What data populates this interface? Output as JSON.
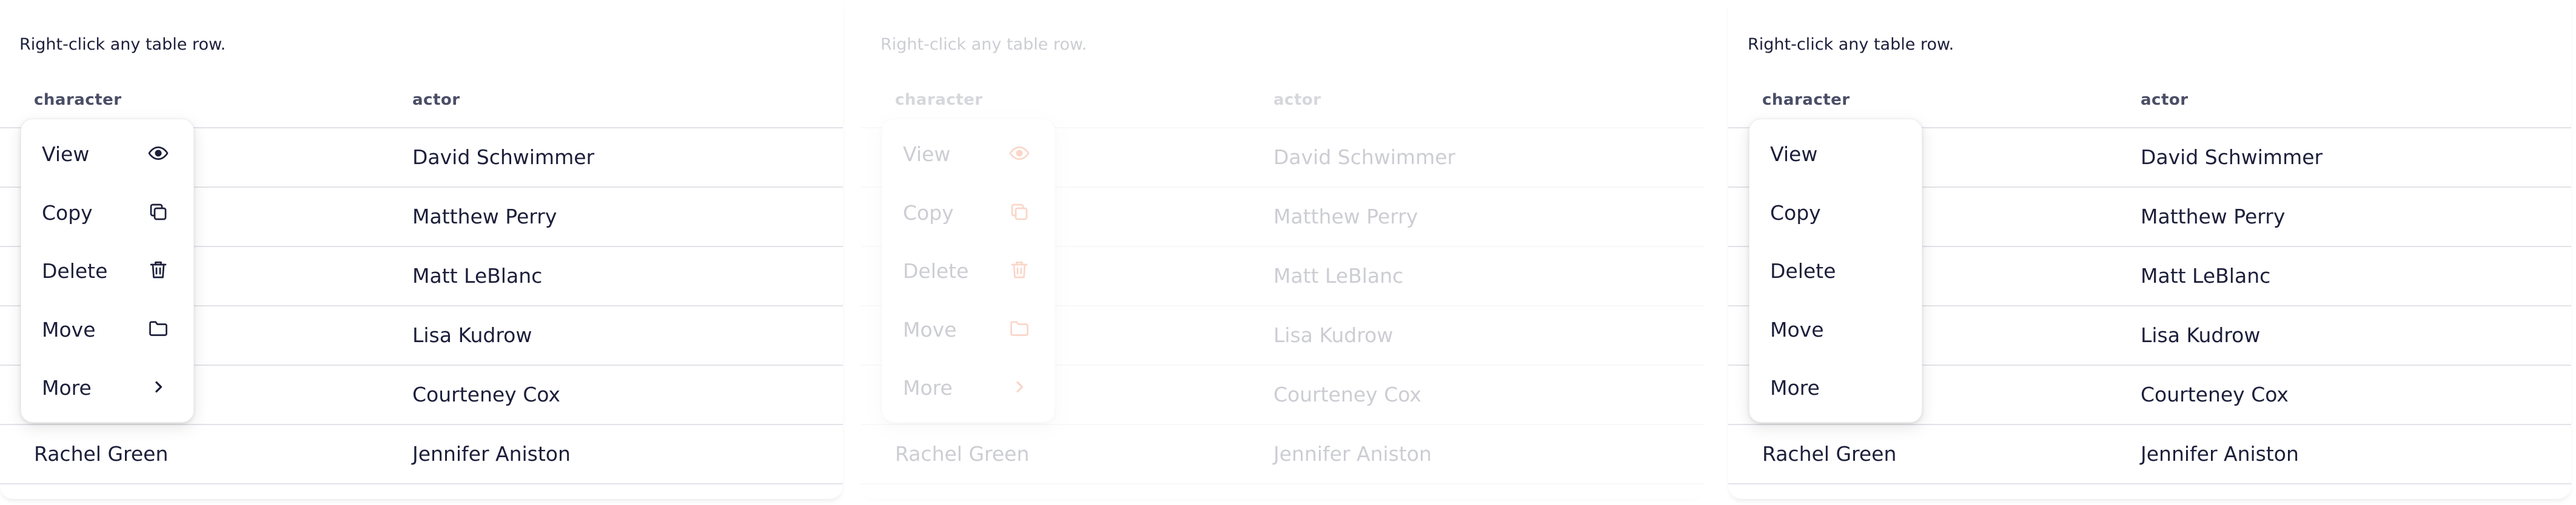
{
  "hint": "Right-click any table row.",
  "table": {
    "headers": [
      "character",
      "actor"
    ],
    "rows": [
      {
        "character": "",
        "actor": "David Schwimmer"
      },
      {
        "character": "",
        "actor": "Matthew Perry"
      },
      {
        "character": "",
        "actor": "Matt LeBlanc"
      },
      {
        "character": "",
        "actor": "Lisa Kudrow"
      },
      {
        "character": "",
        "actor": "Courteney Cox"
      },
      {
        "character": "Rachel Green",
        "actor": "Jennifer Aniston"
      }
    ]
  },
  "menu": {
    "items": [
      {
        "label": "View",
        "icon": "eye-icon"
      },
      {
        "label": "Copy",
        "icon": "copy-icon"
      },
      {
        "label": "Delete",
        "icon": "trash-icon"
      },
      {
        "label": "Move",
        "icon": "folder-icon"
      },
      {
        "label": "More",
        "icon": "chevron-right-icon"
      }
    ]
  },
  "colors": {
    "text": "#1c1f3a",
    "header": "#4a4e66",
    "accent": "#e94a0e",
    "border": "#e2e3e8"
  }
}
